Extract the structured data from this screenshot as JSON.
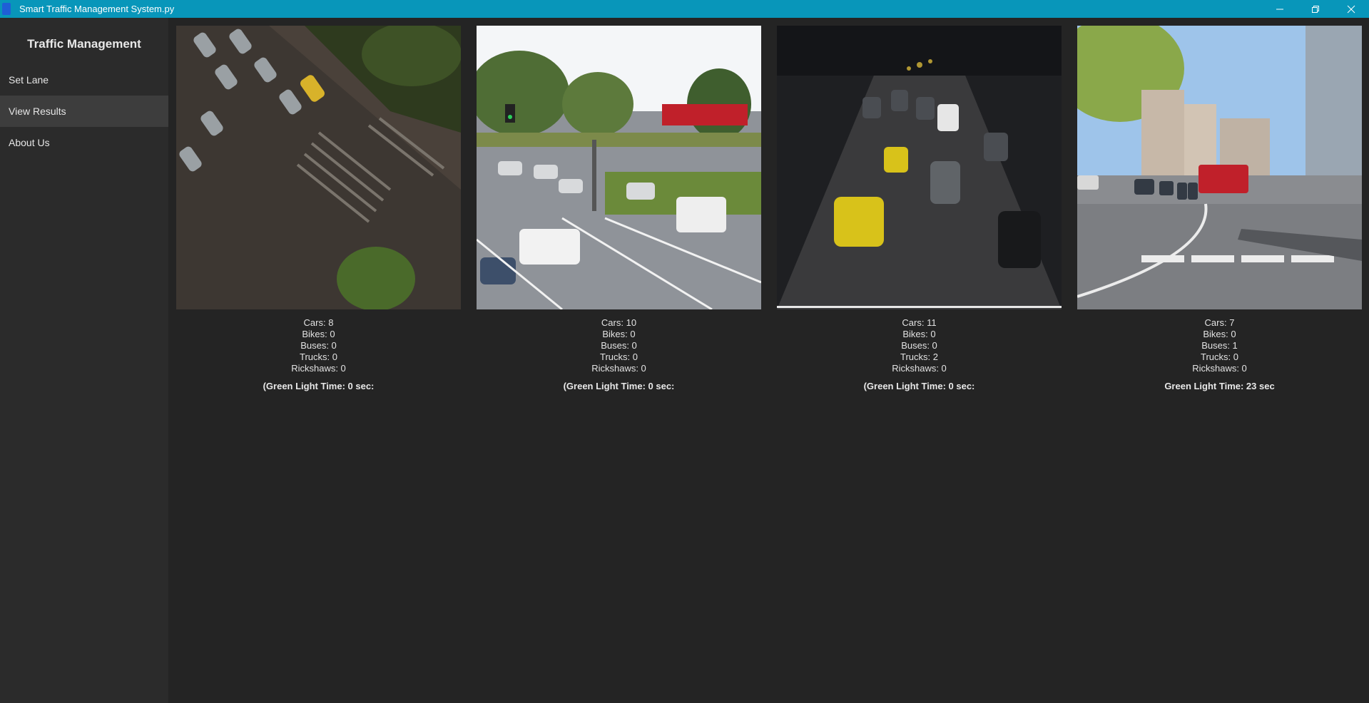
{
  "window": {
    "title": "Smart Traffic Management System.py"
  },
  "sidebar": {
    "title": "Traffic Management",
    "items": [
      {
        "label": "Set Lane"
      },
      {
        "label": "View Results"
      },
      {
        "label": "About Us"
      }
    ]
  },
  "lanes": [
    {
      "cars": "Cars: 8",
      "bikes": "Bikes: 0",
      "buses": "Buses: 0",
      "trucks": "Trucks: 0",
      "rickshaws": "Rickshaws: 0",
      "green": "(Green Light Time: 0 sec:"
    },
    {
      "cars": "Cars: 10",
      "bikes": "Bikes: 0",
      "buses": "Buses: 0",
      "trucks": "Trucks: 0",
      "rickshaws": "Rickshaws: 0",
      "green": "(Green Light Time: 0 sec:"
    },
    {
      "cars": "Cars: 11",
      "bikes": "Bikes: 0",
      "buses": "Buses: 0",
      "trucks": "Trucks: 2",
      "rickshaws": "Rickshaws: 0",
      "green": "(Green Light Time: 0 sec:"
    },
    {
      "cars": "Cars: 7",
      "bikes": "Bikes: 0",
      "buses": "Buses: 1",
      "trucks": "Trucks: 0",
      "rickshaws": "Rickshaws: 0",
      "green": "Green Light Time: 23 sec"
    }
  ],
  "colors": {
    "titlebar": "#0896ba",
    "sidebar": "#2b2b2b",
    "content": "#242424",
    "active_item": "#3d3d3d"
  },
  "icons": [
    "app-icon",
    "minimize-icon",
    "restore-icon",
    "close-icon"
  ]
}
